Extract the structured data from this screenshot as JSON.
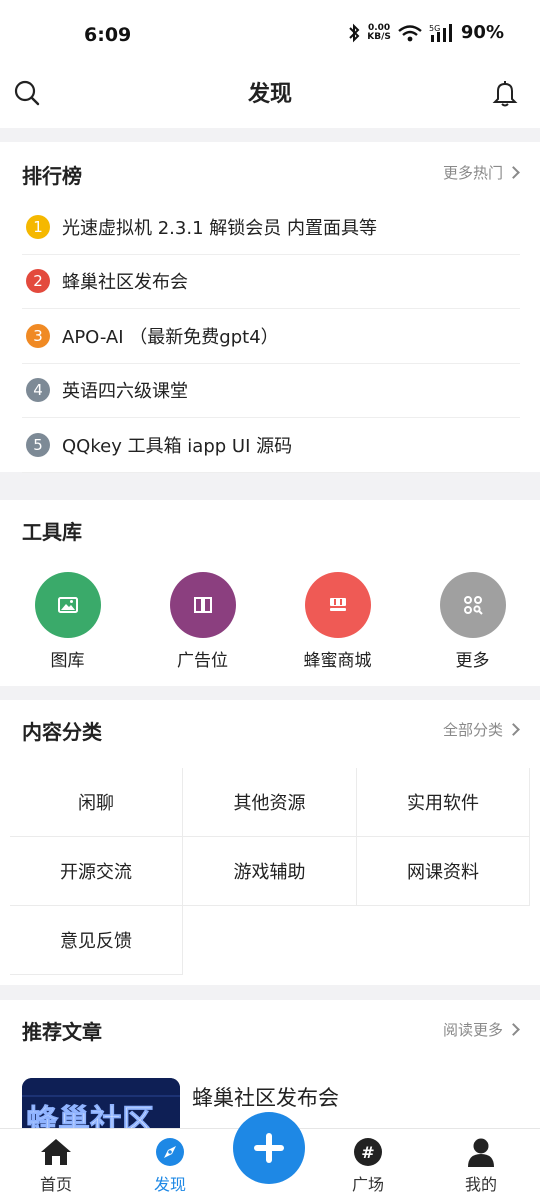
{
  "status": {
    "time": "6:09",
    "net_speed_top": "0.00",
    "net_speed_unit": "KB/S",
    "battery": "90%"
  },
  "header": {
    "title": "发现"
  },
  "ranking": {
    "title": "排行榜",
    "more": "更多热门",
    "items": [
      {
        "rank": "1",
        "text": "光速虚拟机 2.3.1 解锁会员 内置面具等",
        "color": "#f5b800"
      },
      {
        "rank": "2",
        "text": "蜂巢社区发布会",
        "color": "#e34a3d"
      },
      {
        "rank": "3",
        "text": "APO-AI （最新免费gpt4）",
        "color": "#f08a24"
      },
      {
        "rank": "4",
        "text": "英语四六级课堂",
        "color": "#7d8a96"
      },
      {
        "rank": "5",
        "text": "QQkey 工具箱 iapp UI 源码",
        "color": "#7d8a96"
      }
    ]
  },
  "tools": {
    "title": "工具库",
    "items": [
      {
        "label": "图库",
        "color": "#3aaa6a",
        "icon": "image-icon"
      },
      {
        "label": "广告位",
        "color": "#8b3f7f",
        "icon": "book-icon"
      },
      {
        "label": "蜂蜜商城",
        "color": "#ef5a55",
        "icon": "store-icon"
      },
      {
        "label": "更多",
        "color": "#a0a0a0",
        "icon": "apps-icon"
      }
    ]
  },
  "categories": {
    "title": "内容分类",
    "more": "全部分类",
    "items": [
      "闲聊",
      "其他资源",
      "实用软件",
      "开源交流",
      "游戏辅助",
      "网课资料",
      "意见反馈"
    ]
  },
  "articles": {
    "title": "推荐文章",
    "more": "阅读更多",
    "items": [
      {
        "title": "蜂巢社区发布会",
        "thumb_text": "蜂巢社区"
      }
    ]
  },
  "tabbar": {
    "items": [
      {
        "label": "首页",
        "icon": "home-icon"
      },
      {
        "label": "发现",
        "icon": "compass-icon",
        "active": true
      },
      {
        "label": "广场",
        "icon": "hashtag-icon"
      },
      {
        "label": "我的",
        "icon": "user-icon"
      }
    ],
    "accent": "#1e88e5"
  }
}
